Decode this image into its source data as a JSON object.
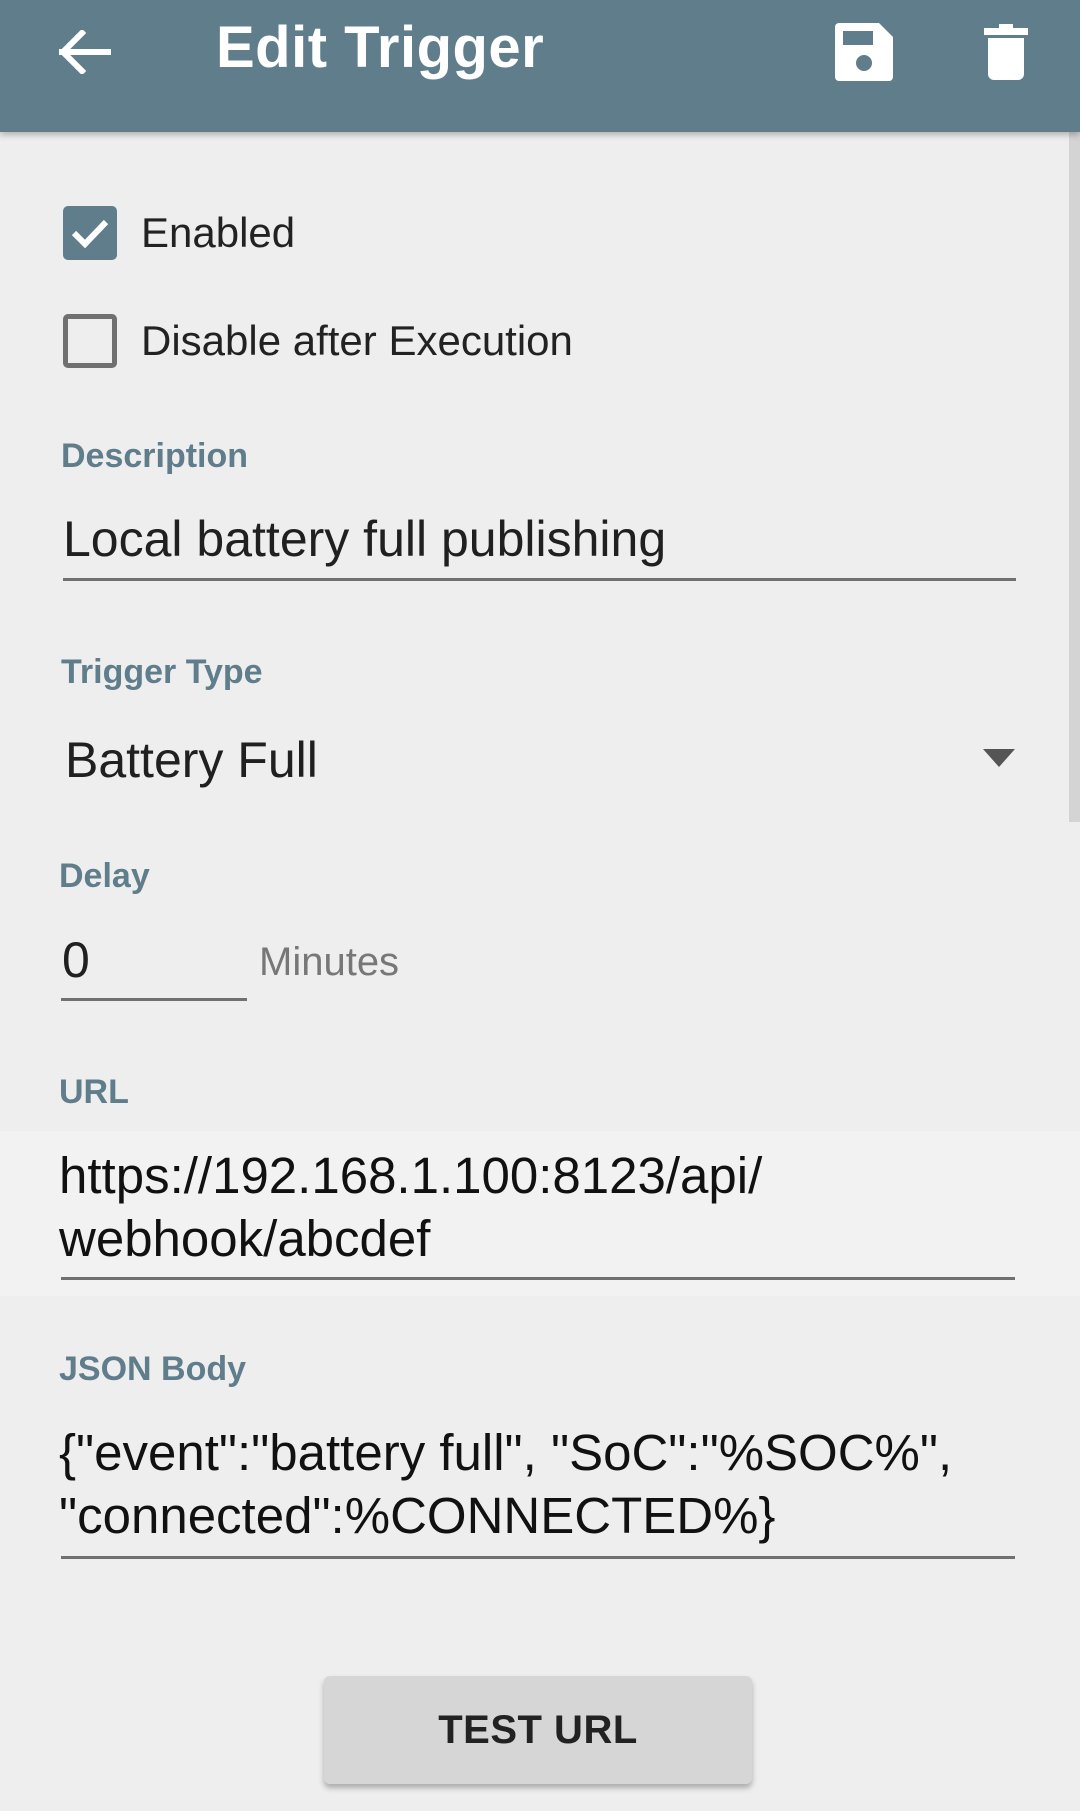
{
  "appbar": {
    "title": "Edit Trigger",
    "back_icon": "arrow-left-icon",
    "save_icon": "floppy-disk-icon",
    "delete_icon": "trash-icon",
    "color": "#607d8b"
  },
  "checkboxes": {
    "enabled": {
      "label": "Enabled",
      "checked": true
    },
    "disable_after": {
      "label": "Disable after Execution",
      "checked": false
    }
  },
  "description": {
    "label": "Description",
    "value": "Local battery full publishing"
  },
  "trigger_type": {
    "label": "Trigger Type",
    "value": "Battery Full"
  },
  "delay": {
    "label": "Delay",
    "value": "0",
    "unit": "Minutes"
  },
  "url": {
    "label": "URL",
    "line1": "https://192.168.1.100:8123/api/",
    "line2": "webhook/abcdef"
  },
  "json_body": {
    "label": "JSON Body",
    "line1": "{\"event\":\"battery full\", \"SoC\":\"%SOC%\",",
    "line2": "\"connected\":%CONNECTED%}"
  },
  "test_button": {
    "label": "TEST URL"
  }
}
